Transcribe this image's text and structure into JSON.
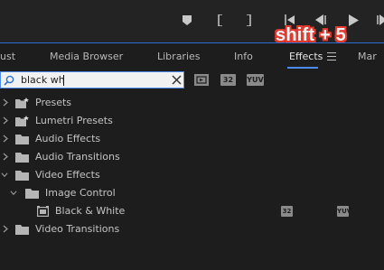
{
  "annotation": {
    "shortcut_hint": "shift + 5"
  },
  "tabs": [
    {
      "label": "ust",
      "active": false
    },
    {
      "label": "Media Browser",
      "active": false
    },
    {
      "label": "Libraries",
      "active": false
    },
    {
      "label": "Info",
      "active": false
    },
    {
      "label": "Effects",
      "active": true
    },
    {
      "label": "Mar",
      "active": false
    }
  ],
  "search": {
    "value": "black wh",
    "placeholder": ""
  },
  "filter_badges": {
    "accelerated": "",
    "bit32": "32",
    "yuv": "YUV"
  },
  "tree": {
    "presets": "Presets",
    "lumetri_presets": "Lumetri Presets",
    "audio_effects": "Audio Effects",
    "audio_transitions": "Audio Transitions",
    "video_effects": "Video Effects",
    "image_control": "Image Control",
    "black_and_white": "Black & White",
    "video_transitions": "Video Transitions"
  },
  "colors": {
    "accent_blue": "#4c8af0",
    "hint_red": "#e23a2f",
    "panel_bg": "#1d1d1d"
  }
}
